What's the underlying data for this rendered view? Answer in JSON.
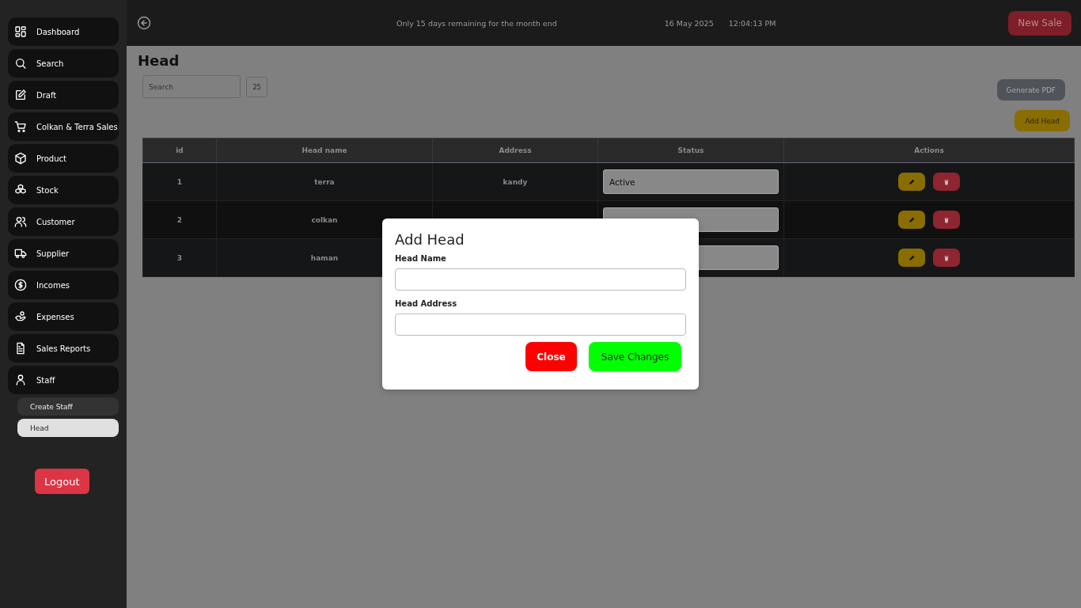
{
  "sidebar": {
    "items": [
      {
        "label": "Dashboard"
      },
      {
        "label": "Search"
      },
      {
        "label": "Draft"
      },
      {
        "label": "Colkan & Terra Sales"
      },
      {
        "label": "Product"
      },
      {
        "label": "Stock"
      },
      {
        "label": "Customer"
      },
      {
        "label": "Supplier"
      },
      {
        "label": "Incomes"
      },
      {
        "label": "Expenses"
      },
      {
        "label": "Sales Reports"
      },
      {
        "label": "Staff",
        "children": [
          {
            "label": "Create Staff",
            "selected": false
          },
          {
            "label": "Head",
            "selected": true
          }
        ]
      }
    ],
    "logout": "Logout"
  },
  "top_bar": {
    "notice": "Only 15 days remaining for the month end",
    "date": "16 May 2025",
    "time": "12:04:13 PM",
    "new_sale": "New Sale"
  },
  "page": {
    "title": "Head",
    "search": {
      "placeholder": "Search"
    },
    "page_size": "25",
    "generate_pdf": "Generate PDF",
    "add_head": "Add Head"
  },
  "table": {
    "columns": [
      "id",
      "Head name",
      "Address",
      "Status",
      "Actions"
    ],
    "rows": [
      {
        "id": "1",
        "name": "terra",
        "address": "kandy",
        "status": "Active"
      },
      {
        "id": "2",
        "name": "colkan"
      },
      {
        "id": "3",
        "name": "haman"
      }
    ]
  },
  "modal": {
    "title": "Add Head",
    "fields": [
      {
        "label": "Head Name"
      },
      {
        "label": "Head Address"
      }
    ],
    "close": "Close",
    "save": "Save Changes"
  }
}
